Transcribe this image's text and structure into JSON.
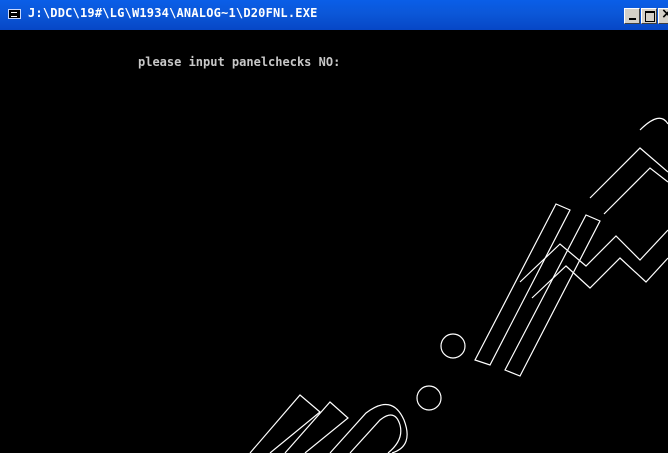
{
  "window": {
    "title": "J:\\DDC\\19#\\LG\\W1934\\ANALOG~1\\D20FNL.EXE",
    "icons": {
      "app": "console-icon",
      "minimize": "minimize-icon",
      "maximize": "maximize-icon",
      "close": "close-icon"
    },
    "colors": {
      "titlebar": "#0b57d8",
      "console_bg": "#000000",
      "console_text": "#c8c8c8"
    }
  },
  "console": {
    "prompt": "please input panelchecks NO:"
  }
}
